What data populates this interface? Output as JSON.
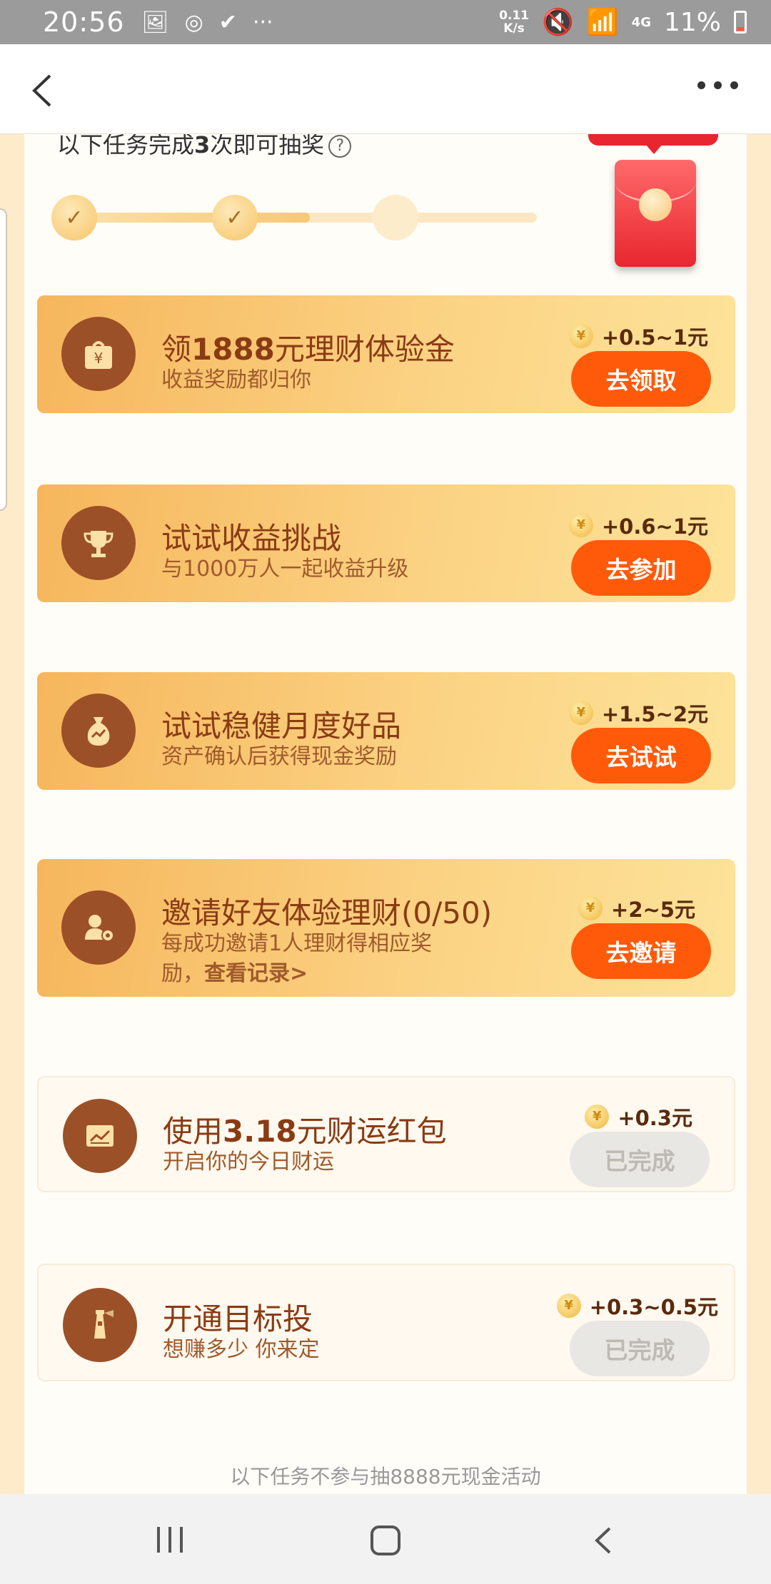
{
  "status_bar": {
    "time": "20:56",
    "net_speed_top": "0.11",
    "net_speed_bottom": "K/s",
    "signal_type": "4G",
    "battery": "11%"
  },
  "icons": {
    "gallery": "image-icon",
    "sync": "sync-icon",
    "dots": "···"
  },
  "progress": {
    "label_prefix": "以下任务完成",
    "label_count": "3",
    "label_suffix": "次即可抽奖",
    "help": "?",
    "completed": 2,
    "total": 3,
    "check": "✓"
  },
  "tasks": [
    {
      "title_a": "领",
      "title_b": "1888",
      "title_c": "元理财体验金",
      "subtitle": "收益奖励都归你",
      "reward": "+0.5~1元",
      "button": "去领取",
      "status": "active",
      "icon": "gift-yuan-icon"
    },
    {
      "title_a": "试试收益挑战",
      "title_b": "",
      "title_c": "",
      "subtitle": "与1000万人一起收益升级",
      "reward": "+0.6~1元",
      "button": "去参加",
      "status": "active",
      "icon": "trophy-icon"
    },
    {
      "title_a": "试试稳健月度好品",
      "title_b": "",
      "title_c": "",
      "subtitle": "资产确认后获得现金奖励",
      "reward": "+1.5~2元",
      "button": "去试试",
      "status": "active",
      "icon": "money-bag-icon"
    },
    {
      "title_a": "邀请好友体验理财(0/50)",
      "title_b": "",
      "title_c": "",
      "subtitle": "每成功邀请1人理财得相应奖",
      "subtitle2": "励，",
      "subtitle_link": "查看记录>",
      "reward": "+2~5元",
      "button": "去邀请",
      "status": "active",
      "icon": "invite-friends-icon"
    },
    {
      "title_a": "使用",
      "title_b": "3.18",
      "title_c": "元财运红包",
      "subtitle": "开启你的今日财运",
      "reward": "+0.3元",
      "button": "已完成",
      "status": "done",
      "icon": "chart-icon"
    },
    {
      "title_a": "开通目标投",
      "title_b": "",
      "title_c": "",
      "subtitle": "想赚多少 你来定",
      "reward": "+0.3~0.5元",
      "button": "已完成",
      "status": "done",
      "icon": "lighthouse-icon"
    }
  ],
  "coin_symbol": "¥",
  "footer_note": "以下任务不参与抽8888元现金活动",
  "colors": {
    "accent": "#ff5a0a",
    "card_brown": "#9c5028",
    "title_brown": "#8a3b14"
  }
}
